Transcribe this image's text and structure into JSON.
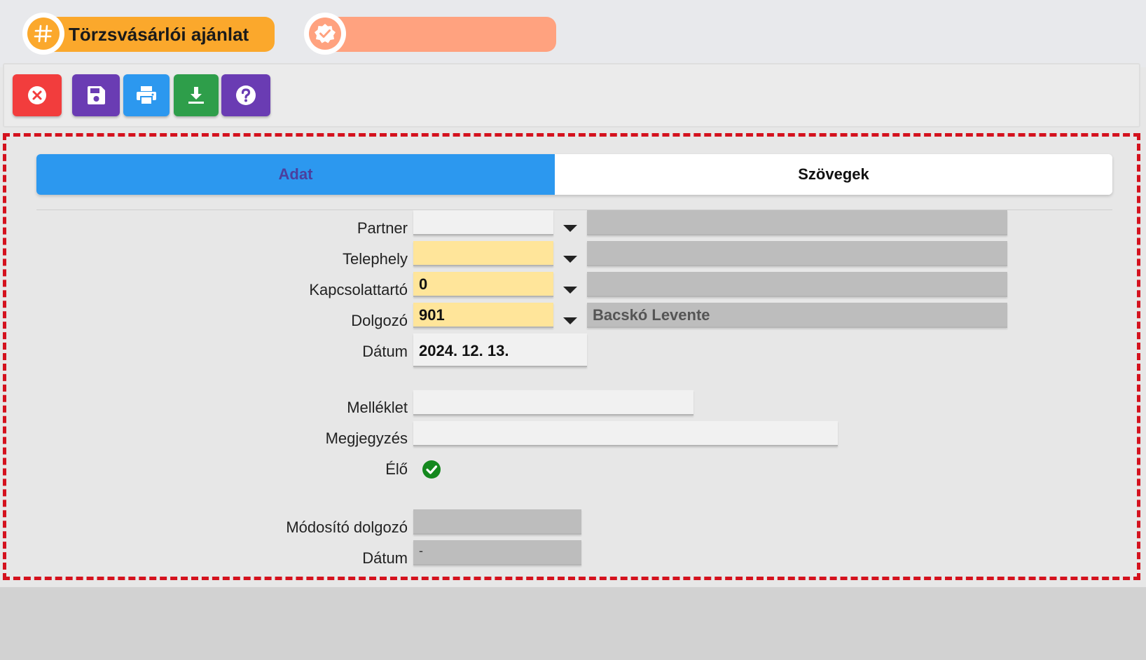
{
  "header": {
    "title": "Törzsvásárlói ajánlat",
    "title_icon": "hash-icon",
    "status_icon": "verified-check-icon",
    "status_text": ""
  },
  "toolbar": {
    "buttons": [
      {
        "name": "close",
        "icon": "close-circle-icon",
        "color": "#f23d3d"
      },
      {
        "name": "save",
        "icon": "floppy-disk-icon",
        "color": "#6a3cb3"
      },
      {
        "name": "print",
        "icon": "printer-icon",
        "color": "#2c98ef"
      },
      {
        "name": "download",
        "icon": "download-icon",
        "color": "#2e9e4a"
      },
      {
        "name": "help",
        "icon": "question-circle-icon",
        "color": "#6a3cb3"
      }
    ]
  },
  "tabs": [
    {
      "label": "Adat",
      "active": true
    },
    {
      "label": "Szövegek",
      "active": false
    }
  ],
  "form": {
    "partner": {
      "label": "Partner",
      "code": "",
      "name": ""
    },
    "telephely": {
      "label": "Telephely",
      "code": "",
      "name": ""
    },
    "kapcsolattarto": {
      "label": "Kapcsolattartó",
      "code": "0",
      "name": ""
    },
    "dolgozo": {
      "label": "Dolgozó",
      "code": "901",
      "name": "Bacskó Levente"
    },
    "datum": {
      "label": "Dátum",
      "value": "2024. 12. 13."
    },
    "melleklet": {
      "label": "Melléklet",
      "value": ""
    },
    "megjegyzes": {
      "label": "Megjegyzés",
      "value": ""
    },
    "elo": {
      "label": "Élő",
      "checked": true
    },
    "modosito_dolgozo": {
      "label": "Módosító dolgozó",
      "value": ""
    },
    "modosito_datum": {
      "label": "Dátum",
      "value": "-"
    }
  },
  "colors": {
    "accent_orange": "#fba82c",
    "status_salmon": "#ffa27f",
    "tab_active": "#2c98ef",
    "required_field": "#ffe59a",
    "panel_border": "#d4121e",
    "check_green": "#14881e"
  }
}
